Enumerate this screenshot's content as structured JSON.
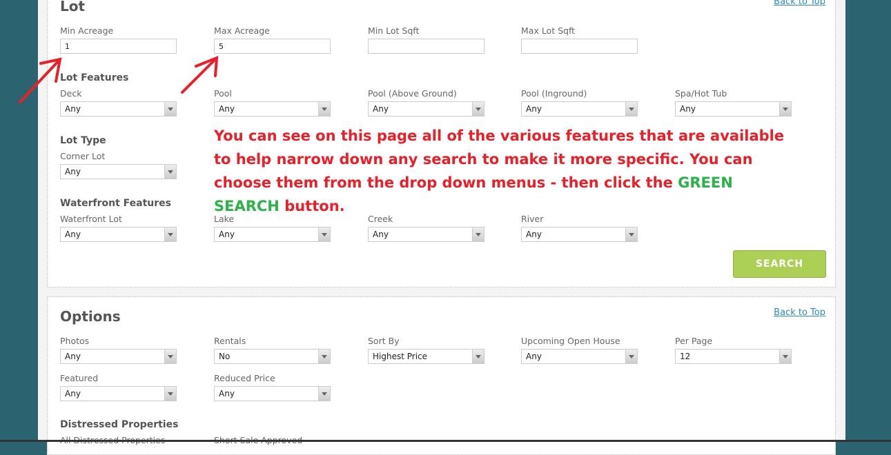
{
  "lot": {
    "title": "Lot",
    "back_to_top": "Back to Top",
    "fields": [
      {
        "label": "Min Acreage",
        "value": "1"
      },
      {
        "label": "Max Acreage",
        "value": "5"
      },
      {
        "label": "Min Lot Sqft",
        "value": ""
      },
      {
        "label": "Max Lot Sqft",
        "value": ""
      }
    ],
    "features_title": "Lot Features",
    "features": [
      {
        "label": "Deck",
        "value": "Any"
      },
      {
        "label": "Pool",
        "value": "Any"
      },
      {
        "label": "Pool (Above Ground)",
        "value": "Any"
      },
      {
        "label": "Pool (Inground)",
        "value": "Any"
      },
      {
        "label": "Spa/Hot Tub",
        "value": "Any"
      }
    ],
    "type_title": "Lot Type",
    "type": [
      {
        "label": "Corner Lot",
        "value": "Any"
      }
    ],
    "water_title": "Waterfront Features",
    "water": [
      {
        "label": "Waterfront Lot",
        "value": "Any"
      },
      {
        "label": "Lake",
        "value": "Any"
      },
      {
        "label": "Creek",
        "value": "Any"
      },
      {
        "label": "River",
        "value": "Any"
      }
    ],
    "search_label": "SEARCH"
  },
  "annotation": {
    "text_before": "You can see on this page all of the various features that are available to help narrow down any search to make it more specific. You can choose them from the drop down menus - then click the ",
    "highlight": "GREEN SEARCH",
    "text_after": " button.",
    "color": "#e8202a",
    "highlight_color": "#2db24a"
  },
  "options": {
    "title": "Options",
    "back_to_top": "Back to Top",
    "row1": [
      {
        "label": "Photos",
        "value": "Any"
      },
      {
        "label": "Rentals",
        "value": "No"
      },
      {
        "label": "Sort By",
        "value": "Highest Price"
      },
      {
        "label": "Upcoming Open House",
        "value": "Any"
      },
      {
        "label": "Per Page",
        "value": "12"
      }
    ],
    "row2": [
      {
        "label": "Featured",
        "value": "Any"
      },
      {
        "label": "Reduced Price",
        "value": "Any"
      }
    ],
    "distressed_title": "Distressed Properties",
    "distressed": [
      {
        "label": "All Distressed Properties"
      },
      {
        "label": "Short Sale Approved"
      }
    ]
  }
}
